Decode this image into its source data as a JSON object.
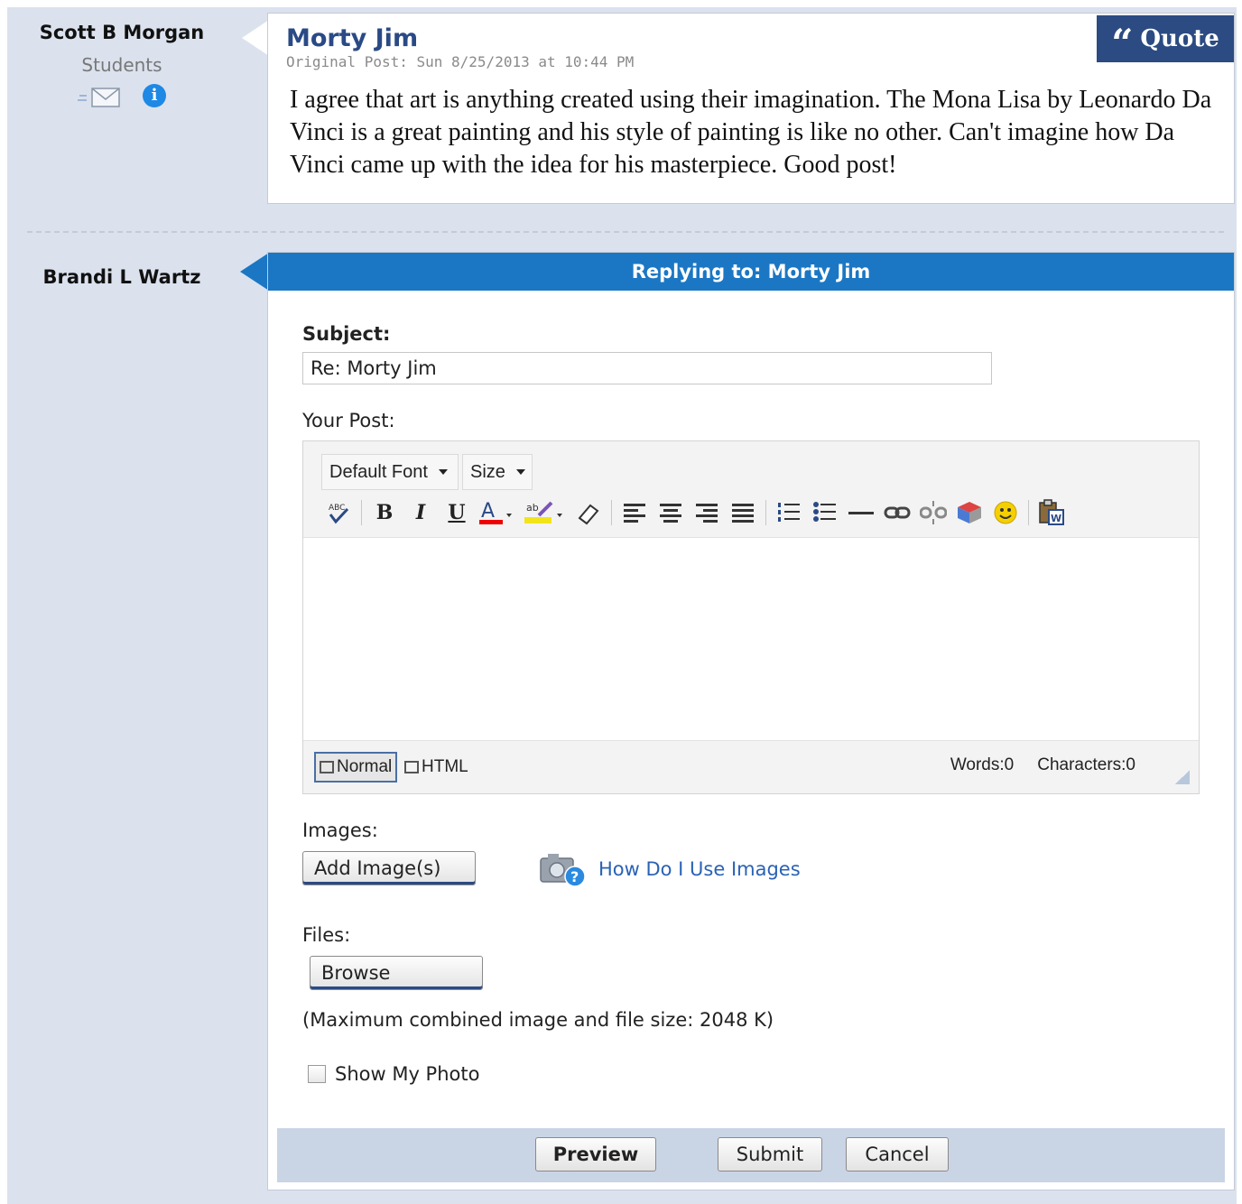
{
  "original_author": {
    "name": "Scott B Morgan",
    "role": "Students",
    "icons": [
      "mail-icon",
      "info-icon"
    ]
  },
  "original_post": {
    "title": "Morty Jim",
    "meta": "Original Post: Sun 8/25/2013 at 10:44 PM",
    "quote_label": "Quote",
    "body": "I agree that art is anything created using their imagination. The Mona Lisa by Leonardo Da Vinci is a great painting and his style of painting is like no other. Can't imagine how Da Vinci came up with the idea for his masterpiece. Good post!"
  },
  "reply_author": {
    "name": "Brandi L Wartz"
  },
  "reply": {
    "header": "Replying to: Morty Jim",
    "subject_label": "Subject:",
    "subject_value": "Re: Morty Jim",
    "post_label": "Your Post:",
    "editor": {
      "font_select": "Default Font",
      "size_select": "Size",
      "toolbar_icons": [
        "spellcheck-icon",
        "bold-icon",
        "italic-icon",
        "underline-icon",
        "font-color-icon",
        "highlight-icon",
        "eraser-icon",
        "align-left-icon",
        "align-center-icon",
        "align-right-icon",
        "justify-icon",
        "ordered-list-icon",
        "unordered-list-icon",
        "horizontal-rule-icon",
        "link-icon",
        "unlink-icon",
        "insert-object-icon",
        "smiley-icon",
        "paste-word-icon"
      ],
      "mode_normal": "Normal",
      "mode_html": "HTML",
      "words": "Words:0",
      "characters": "Characters:0"
    },
    "images_label": "Images:",
    "add_images_button": "Add Image(s)",
    "help_link": "How Do I Use Images",
    "files_label": "Files:",
    "browse_button": "Browse",
    "size_note": "(Maximum combined image and file size: 2048 K)",
    "show_photo_label": "Show My Photo",
    "show_photo_checked": false,
    "preview_button": "Preview",
    "submit_button": "Submit",
    "cancel_button": "Cancel"
  },
  "colors": {
    "frame_bg": "#dbe2ee",
    "header_blue": "#1b77c4",
    "quote_navy": "#2b4b82",
    "author_title": "#2a4a86",
    "link_blue": "#2a62b5",
    "action_bar": "#c9d5e5"
  }
}
